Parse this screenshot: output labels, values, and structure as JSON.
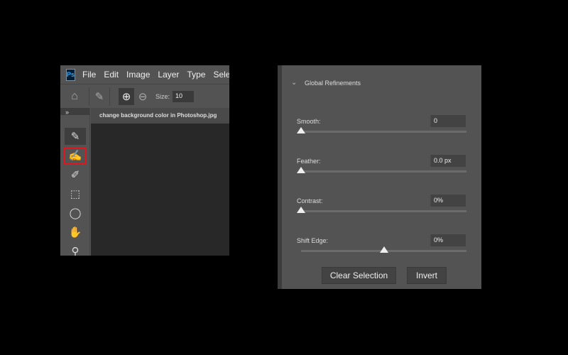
{
  "menubar": {
    "logo": "Ps",
    "items": [
      "File",
      "Edit",
      "Image",
      "Layer",
      "Type",
      "Sele"
    ]
  },
  "options": {
    "size_label": "Size:",
    "size_value": "10"
  },
  "document_tab": "change background color in Photoshop.jpg",
  "panel": {
    "collapse_arrows": "»",
    "section_title": "Global Refinements",
    "sliders": [
      {
        "label": "Smooth:",
        "value": "0",
        "position_pct": 0
      },
      {
        "label": "Feather:",
        "value": "0.0 px",
        "position_pct": 0
      },
      {
        "label": "Contrast:",
        "value": "0%",
        "position_pct": 0
      },
      {
        "label": "Shift Edge:",
        "value": "0%",
        "position_pct": 50
      }
    ],
    "clear_selection": "Clear Selection",
    "invert": "Invert"
  },
  "colors": {
    "highlight": "#e0161e",
    "panel_bg": "#535353",
    "canvas_bg": "#282828"
  }
}
